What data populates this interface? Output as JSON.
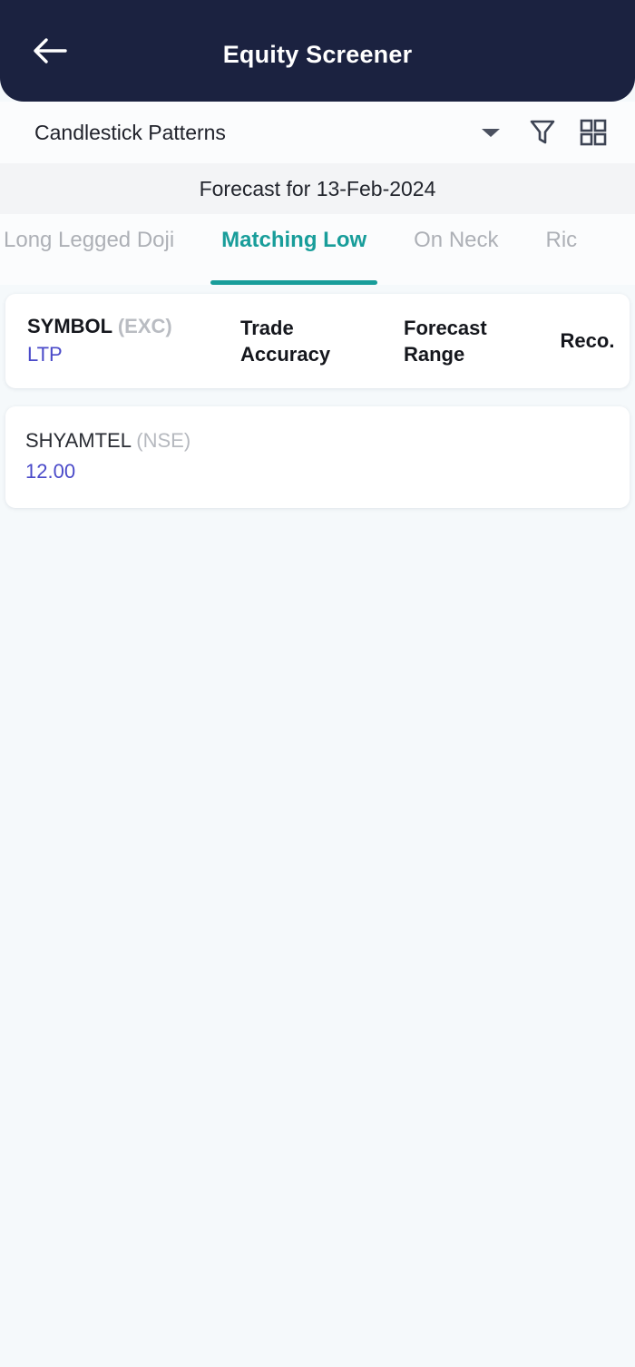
{
  "appbar": {
    "title": "Equity Screener",
    "back_icon": "arrow-left-icon"
  },
  "selector": {
    "value": "Candlestick Patterns",
    "dropdown_icon": "chevron-down-icon",
    "filter_icon": "filter-icon",
    "grid_icon": "grid-view-icon"
  },
  "forecast": {
    "text": "Forecast for 13-Feb-2024"
  },
  "tabs": {
    "active_index": 1,
    "items": [
      {
        "label": "Long Legged Doji"
      },
      {
        "label": "Matching Low"
      },
      {
        "label": "On Neck"
      },
      {
        "label": "Ric"
      }
    ]
  },
  "table": {
    "header": {
      "symbol": "SYMBOL",
      "exchange": "(EXC)",
      "ltp": "LTP",
      "trade_accuracy_line1": "Trade",
      "trade_accuracy_line2": "Accuracy",
      "forecast_range_line1": "Forecast",
      "forecast_range_line2": "Range",
      "reco": "Reco."
    },
    "rows": [
      {
        "symbol": "SHYAMTEL",
        "exchange": "(NSE)",
        "ltp": "12.00",
        "trade_accuracy": "",
        "forecast_range": "",
        "reco": ""
      }
    ]
  },
  "colors": {
    "appbar_bg": "#1b2240",
    "accent_teal": "#189d9a",
    "ltp_blue": "#4a4ac9",
    "page_bg": "#f5f9fb",
    "strip_bg": "#f3f4f6"
  }
}
